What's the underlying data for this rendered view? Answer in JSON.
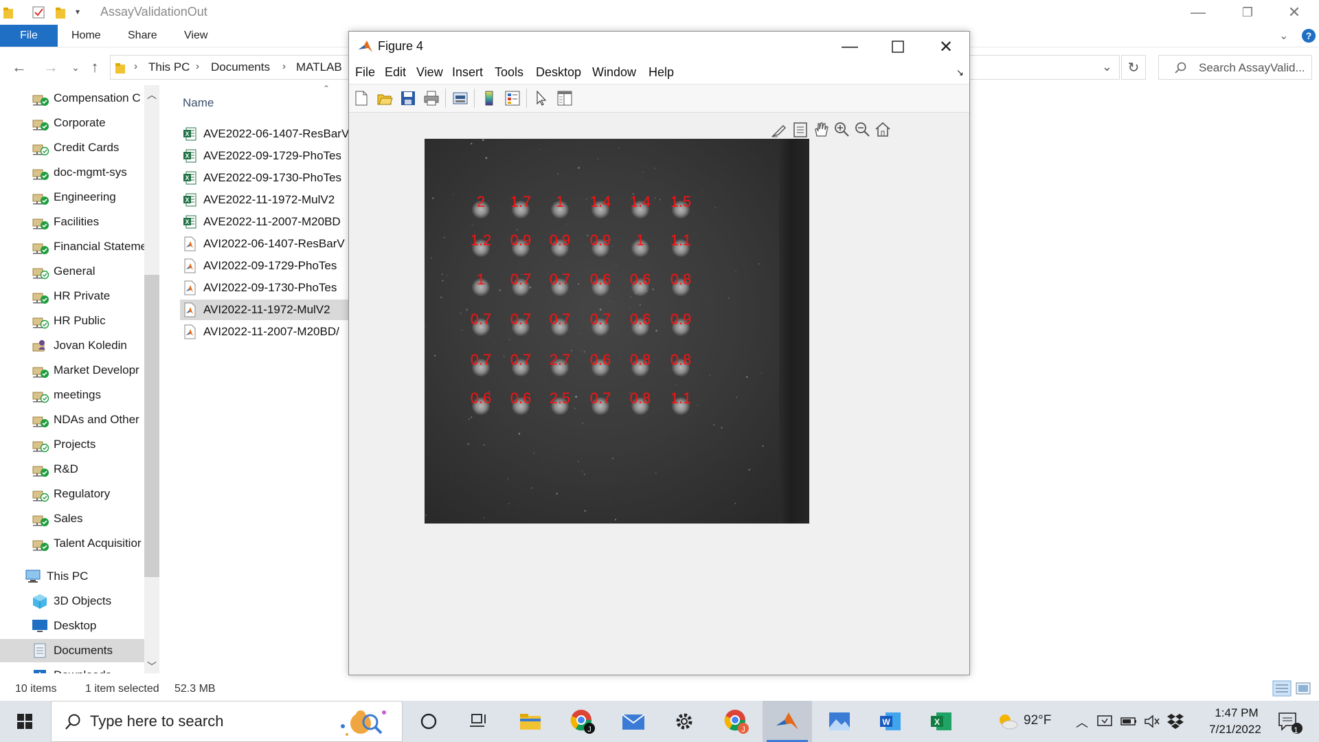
{
  "explorer": {
    "title": "AssayValidationOut",
    "ribbon_tabs": [
      "File",
      "Home",
      "Share",
      "View"
    ],
    "breadcrumb": [
      "This PC",
      "Documents",
      "MATLAB"
    ],
    "search_placeholder": "Search AssayValid...",
    "nav_items": [
      {
        "label": "Compensation C",
        "icon": "network-folder-sync-icon"
      },
      {
        "label": "Corporate",
        "icon": "network-folder-sync-icon"
      },
      {
        "label": "Credit Cards",
        "icon": "network-folder-icon"
      },
      {
        "label": "doc-mgmt-sys",
        "icon": "network-folder-sync-icon"
      },
      {
        "label": "Engineering",
        "icon": "network-folder-sync-icon"
      },
      {
        "label": "Facilities",
        "icon": "network-folder-sync-icon"
      },
      {
        "label": "Financial Stateme",
        "icon": "network-folder-sync-icon"
      },
      {
        "label": "General",
        "icon": "network-folder-icon"
      },
      {
        "label": "HR Private",
        "icon": "network-folder-sync-icon"
      },
      {
        "label": "HR Public",
        "icon": "network-folder-icon"
      },
      {
        "label": "Jovan Koledin",
        "icon": "user-folder-icon"
      },
      {
        "label": "Market Developr",
        "icon": "network-folder-sync-icon"
      },
      {
        "label": "meetings",
        "icon": "network-folder-icon"
      },
      {
        "label": "NDAs and Other",
        "icon": "network-folder-sync-icon"
      },
      {
        "label": "Projects",
        "icon": "network-folder-icon"
      },
      {
        "label": "R&D",
        "icon": "network-folder-sync-icon"
      },
      {
        "label": "Regulatory",
        "icon": "network-folder-icon"
      },
      {
        "label": "Sales",
        "icon": "network-folder-sync-icon"
      },
      {
        "label": "Talent Acquisitior",
        "icon": "network-folder-sync-icon"
      }
    ],
    "this_pc_label": "This PC",
    "pc_items": [
      {
        "label": "3D Objects",
        "icon": "3d-objects-icon"
      },
      {
        "label": "Desktop",
        "icon": "desktop-icon"
      },
      {
        "label": "Documents",
        "icon": "documents-icon"
      },
      {
        "label": "Downloads",
        "icon": "downloads-icon"
      }
    ],
    "column_header": "Name",
    "files": [
      {
        "name": "AVE2022-06-1407-ResBarV",
        "icon": "excel-file-icon"
      },
      {
        "name": "AVE2022-09-1729-PhoTes",
        "icon": "excel-file-icon"
      },
      {
        "name": "AVE2022-09-1730-PhoTes",
        "icon": "excel-file-icon"
      },
      {
        "name": "AVE2022-11-1972-MulV2",
        "icon": "excel-file-icon"
      },
      {
        "name": "AVE2022-11-2007-M20BD",
        "icon": "excel-file-icon"
      },
      {
        "name": "AVI2022-06-1407-ResBarV",
        "icon": "matlab-figure-file-icon"
      },
      {
        "name": "AVI2022-09-1729-PhoTes",
        "icon": "matlab-figure-file-icon"
      },
      {
        "name": "AVI2022-09-1730-PhoTes",
        "icon": "matlab-figure-file-icon"
      },
      {
        "name": "AVI2022-11-1972-MulV2",
        "icon": "matlab-figure-file-icon",
        "selected": true
      },
      {
        "name": "AVI2022-11-2007-M20BD/",
        "icon": "matlab-figure-file-icon"
      }
    ],
    "status_items": "10 items",
    "status_selected": "1 item selected",
    "status_size": "52.3 MB"
  },
  "figure": {
    "title": "Figure 4",
    "menus": [
      "File",
      "Edit",
      "View",
      "Insert",
      "Tools",
      "Desktop",
      "Window",
      "Help"
    ],
    "toolbar_icons": [
      "new-figure-icon",
      "open-file-icon",
      "save-icon",
      "print-icon",
      "link-plot-icon",
      "colorbar-icon",
      "legend-icon",
      "edit-plot-icon",
      "property-inspector-icon"
    ],
    "axes_toolbar_icons": [
      "brush-icon",
      "data-tips-icon",
      "pan-icon",
      "zoom-in-icon",
      "zoom-out-icon",
      "home-icon"
    ],
    "spot_rows": [
      [
        "2",
        "1.7",
        "1",
        "1.4",
        "1.4",
        "1.5"
      ],
      [
        "1.2",
        "0.9",
        "0.9",
        "0.9",
        "1",
        "1.1"
      ],
      [
        "1",
        "0.7",
        "0.7",
        "0.6",
        "0.6",
        "0.8"
      ],
      [
        "0.7",
        "0.7",
        "0.7",
        "0.7",
        "0.6",
        "0.9"
      ],
      [
        "0.7",
        "0.7",
        "2.7",
        "0.6",
        "0.8",
        "0.8"
      ],
      [
        "0.6",
        "0.6",
        "2.5",
        "0.7",
        "0.8",
        "1.1"
      ]
    ],
    "label_color": "#ff1010"
  },
  "taskbar": {
    "search_placeholder": "Type here to search",
    "apps": [
      "cortana-icon",
      "task-view-icon",
      "file-explorer-icon",
      "chrome-icon",
      "mail-icon",
      "settings-icon",
      "chrome-profile-icon",
      "matlab-icon",
      "photos-icon",
      "word-icon",
      "excel-icon"
    ],
    "active_app": "matlab-icon",
    "weather": "92°F",
    "time": "1:47 PM",
    "date": "7/21/2022",
    "notification_count": "1"
  },
  "colors": {
    "accent": "#1f6fc5",
    "selection": "#d9d9d9",
    "taskbar": "#dfe4eb"
  }
}
